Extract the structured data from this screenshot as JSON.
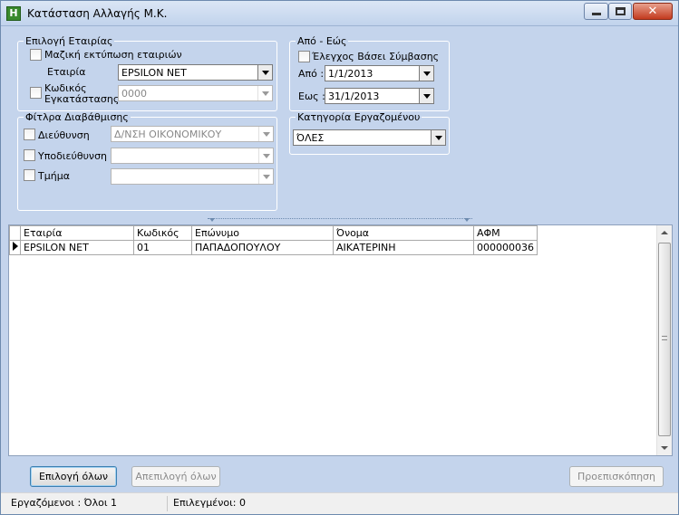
{
  "window": {
    "title": "Κατάσταση Αλλαγής Μ.Κ.",
    "minimize_label": "—",
    "close_label": "✕"
  },
  "company_group": {
    "legend": "Επιλογή Εταιρίας",
    "bulk_print_label": "Μαζική εκτύπωση εταιριών",
    "company_label": "Εταιρία",
    "company_value": "EPSILON NET",
    "install_code_label_line1": "Κωδικός",
    "install_code_label_line2": "Εγκατάστασης",
    "install_code_value": "0000"
  },
  "period_group": {
    "legend": "Από - Εώς",
    "contract_check_label": "Έλεγχος Βάσει Σύμβασης",
    "from_label": "Από :",
    "from_value": "1/1/2013",
    "to_label": "Εως :",
    "to_value": "31/1/2013"
  },
  "filter_group": {
    "legend": "Φίτλρα Διαβάθμισης",
    "directorate_label": "Διεύθυνση",
    "directorate_value": "Δ/ΝΣΗ ΟΙΚΟΝΟΜΙΚΟΥ",
    "subdirectorate_label": "Υποδιεύθυνση",
    "subdirectorate_value": "",
    "department_label": "Τμήμα",
    "department_value": ""
  },
  "employee_category_group": {
    "legend": "Κατηγορία Εργαζομένου",
    "value": "ΌΛΕΣ"
  },
  "grid": {
    "columns": [
      "Εταιρία",
      "Κωδικός",
      "Επώνυμο",
      "Όνομα",
      "ΑΦΜ"
    ],
    "rows": [
      [
        "EPSILON NET",
        "01",
        "ΠΑΠΑΔΟΠΟΥΛΟΥ",
        "ΑΙΚΑΤΕΡΙΝΗ",
        "000000036"
      ]
    ]
  },
  "buttons": {
    "select_all": "Επιλογή όλων",
    "deselect_all": "Απεπιλογή όλων",
    "preview": "Προεπισκόπηση"
  },
  "status": {
    "employees": "Εργαζόμενοι :  Όλοι 1",
    "selected": "Επιλεγμένοι: 0"
  }
}
